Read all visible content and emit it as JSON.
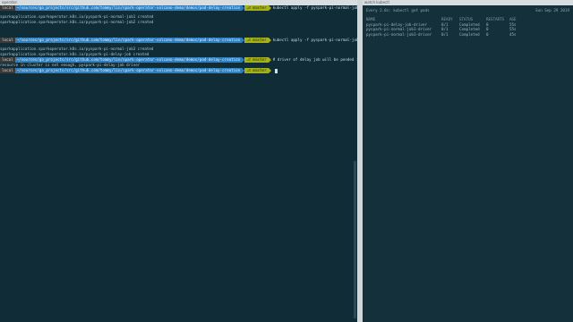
{
  "left_terminal": {
    "window_title": "operator",
    "lines": [
      {
        "type": "prompt",
        "user": "local",
        "path": "~/sources/go_projects/src/github.com/tommy/lin/spark-operator-volcano-demo/demos/pod-delay-creation",
        "git": "master",
        "command": "kubectl apply -f pyspark-pi-normal-job.yaml"
      },
      {
        "type": "output",
        "text": "sparkapplication.sparkoperator.k8s.io/pyspark-pi-normal-job1 created"
      },
      {
        "type": "output",
        "text": "sparkapplication.sparkoperator.k8s.io/pyspark-pi-normal-job2 created"
      },
      {
        "type": "prompt",
        "user": "local",
        "path": "~/sources/go_projects/src/github.com/tommy/lin/spark-operator-volcano-demo/demos/pod-delay-creation",
        "git": "master",
        "command": "kubectl apply -f pyspark-pi-normal-job.yaml"
      },
      {
        "type": "output",
        "text": "sparkapplication.sparkoperator.k8s.io/pyspark-pi-normal-job3 created"
      },
      {
        "type": "output",
        "text": "sparkapplication.sparkoperator.k8s.io/pyspark-pi-delay-job created"
      },
      {
        "type": "prompt",
        "user": "local",
        "path": "~/sources/go_projects/src/github.com/tommy/lin/spark-operator-volcano-demo/demos/pod-delay-creation",
        "git": "master",
        "command": "# driver of delay job will be pended if"
      },
      {
        "type": "output",
        "text": "resource in cluster is not enough, pyspark-pi-delay-job driver"
      },
      {
        "type": "prompt",
        "user": "local",
        "path": "~/sources/go_projects/src/github.com/tommy/lin/spark-operator-volcano-demo/demos/pod-delay-creation",
        "git": "master",
        "command": "",
        "cursor": true
      }
    ]
  },
  "right_terminal": {
    "window_title": "watch kubectl",
    "header": "Every 2.0s: kubectl get pods",
    "clock": "Sun Sep 29 2019",
    "columns": [
      "NAME",
      "READY",
      "STATUS",
      "RESTARTS",
      "AGE"
    ],
    "rows": [
      [
        "pyspark-pi-delay-job-driver",
        "0/1",
        "Completed",
        "0",
        "55s"
      ],
      [
        "pyspark-pi-normal-job1-driver",
        "0/1",
        "Completed",
        "0",
        "55s"
      ],
      [
        "pyspark-pi-normal-job3-driver",
        "0/1",
        "Completed",
        "0",
        "45s"
      ]
    ]
  }
}
